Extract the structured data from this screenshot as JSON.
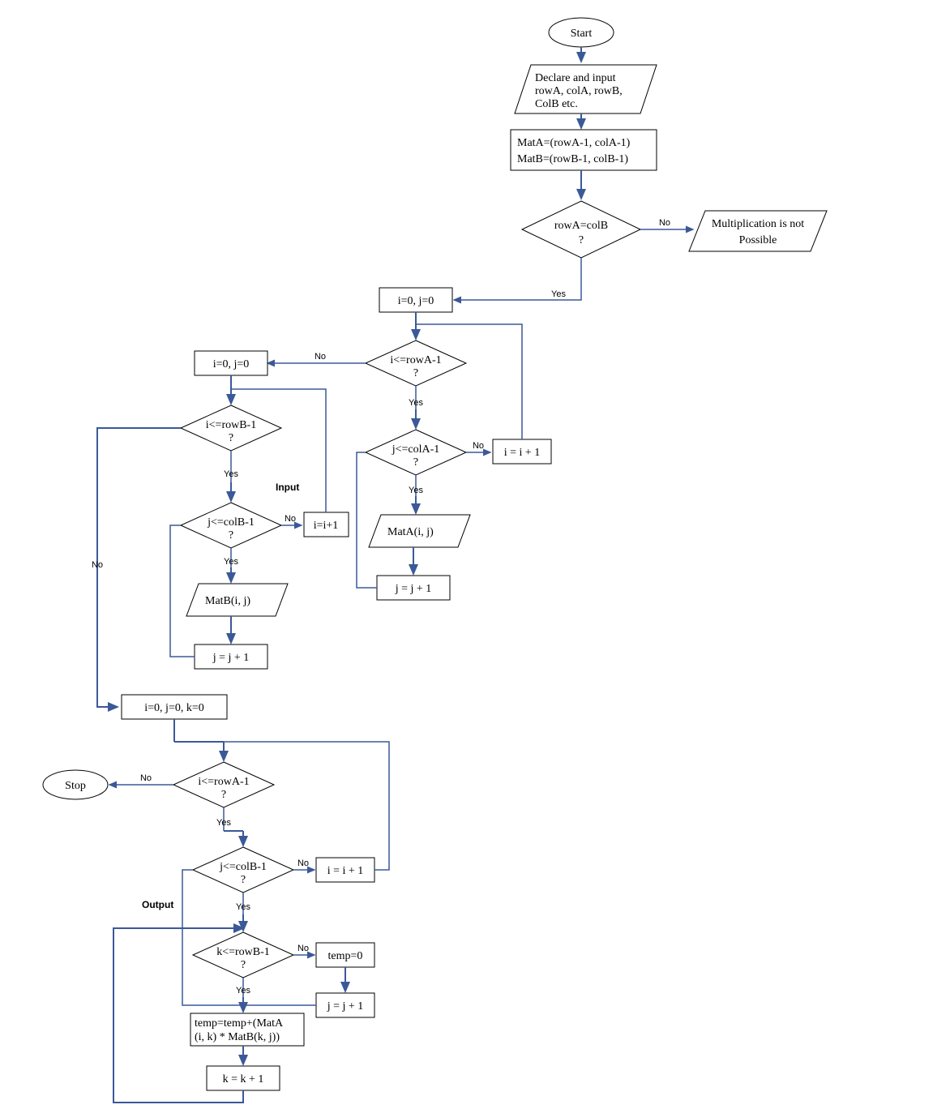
{
  "start": "Start",
  "stop": "Stop",
  "io_declare": "Declare and input rowA, colA, rowB, ColB etc.",
  "proc_mat": {
    "l1": "MatA=(rowA-1, colA-1)",
    "l2": "MatB=(rowB-1, colB-1)"
  },
  "d_rowAcolB": {
    "l1": "rowA=colB",
    "l2": "?"
  },
  "io_notpossible": {
    "l1": "Multiplication is not",
    "l2": "Possible"
  },
  "p_i0j0_A": "i=0, j=0",
  "d_irowA_A": {
    "l1": "i<=rowA-1",
    "l2": "?"
  },
  "d_jcolA": {
    "l1": "j<=colA-1",
    "l2": "?"
  },
  "p_iinc_A": "i = i + 1",
  "io_matA": "MatA(i, j)",
  "p_jinc_A": "j = j + 1",
  "p_i0j0_B": "i=0,  j=0",
  "d_irowB": {
    "l1": "i<=rowB-1",
    "l2": "?"
  },
  "d_jcolB": {
    "l1": "j<=colB-1",
    "l2": "?"
  },
  "p_iinc_B": "i=i+1",
  "io_matB": "MatB(i, j)",
  "p_jinc_B": "j = j + 1",
  "p_i0j0k0": "i=0, j=0, k=0",
  "d_irowA_C": {
    "l1": "i<=rowA-1",
    "l2": "?"
  },
  "d_jcolB_C": {
    "l1": "j<=colB-1",
    "l2": "?"
  },
  "p_iinc_C": "i = i + 1",
  "d_krowB": {
    "l1": "k<=rowB-1",
    "l2": "?"
  },
  "p_temp0": "temp=0",
  "p_jinc_C": "j = j + 1",
  "p_tempcalc": {
    "l1": "temp=temp+(MatA",
    "l2": "(i, k) * MatB(k, j))"
  },
  "p_kinc": "k = k + 1",
  "label": {
    "yes": "Yes",
    "no": "No",
    "input": "Input",
    "output": "Output"
  }
}
